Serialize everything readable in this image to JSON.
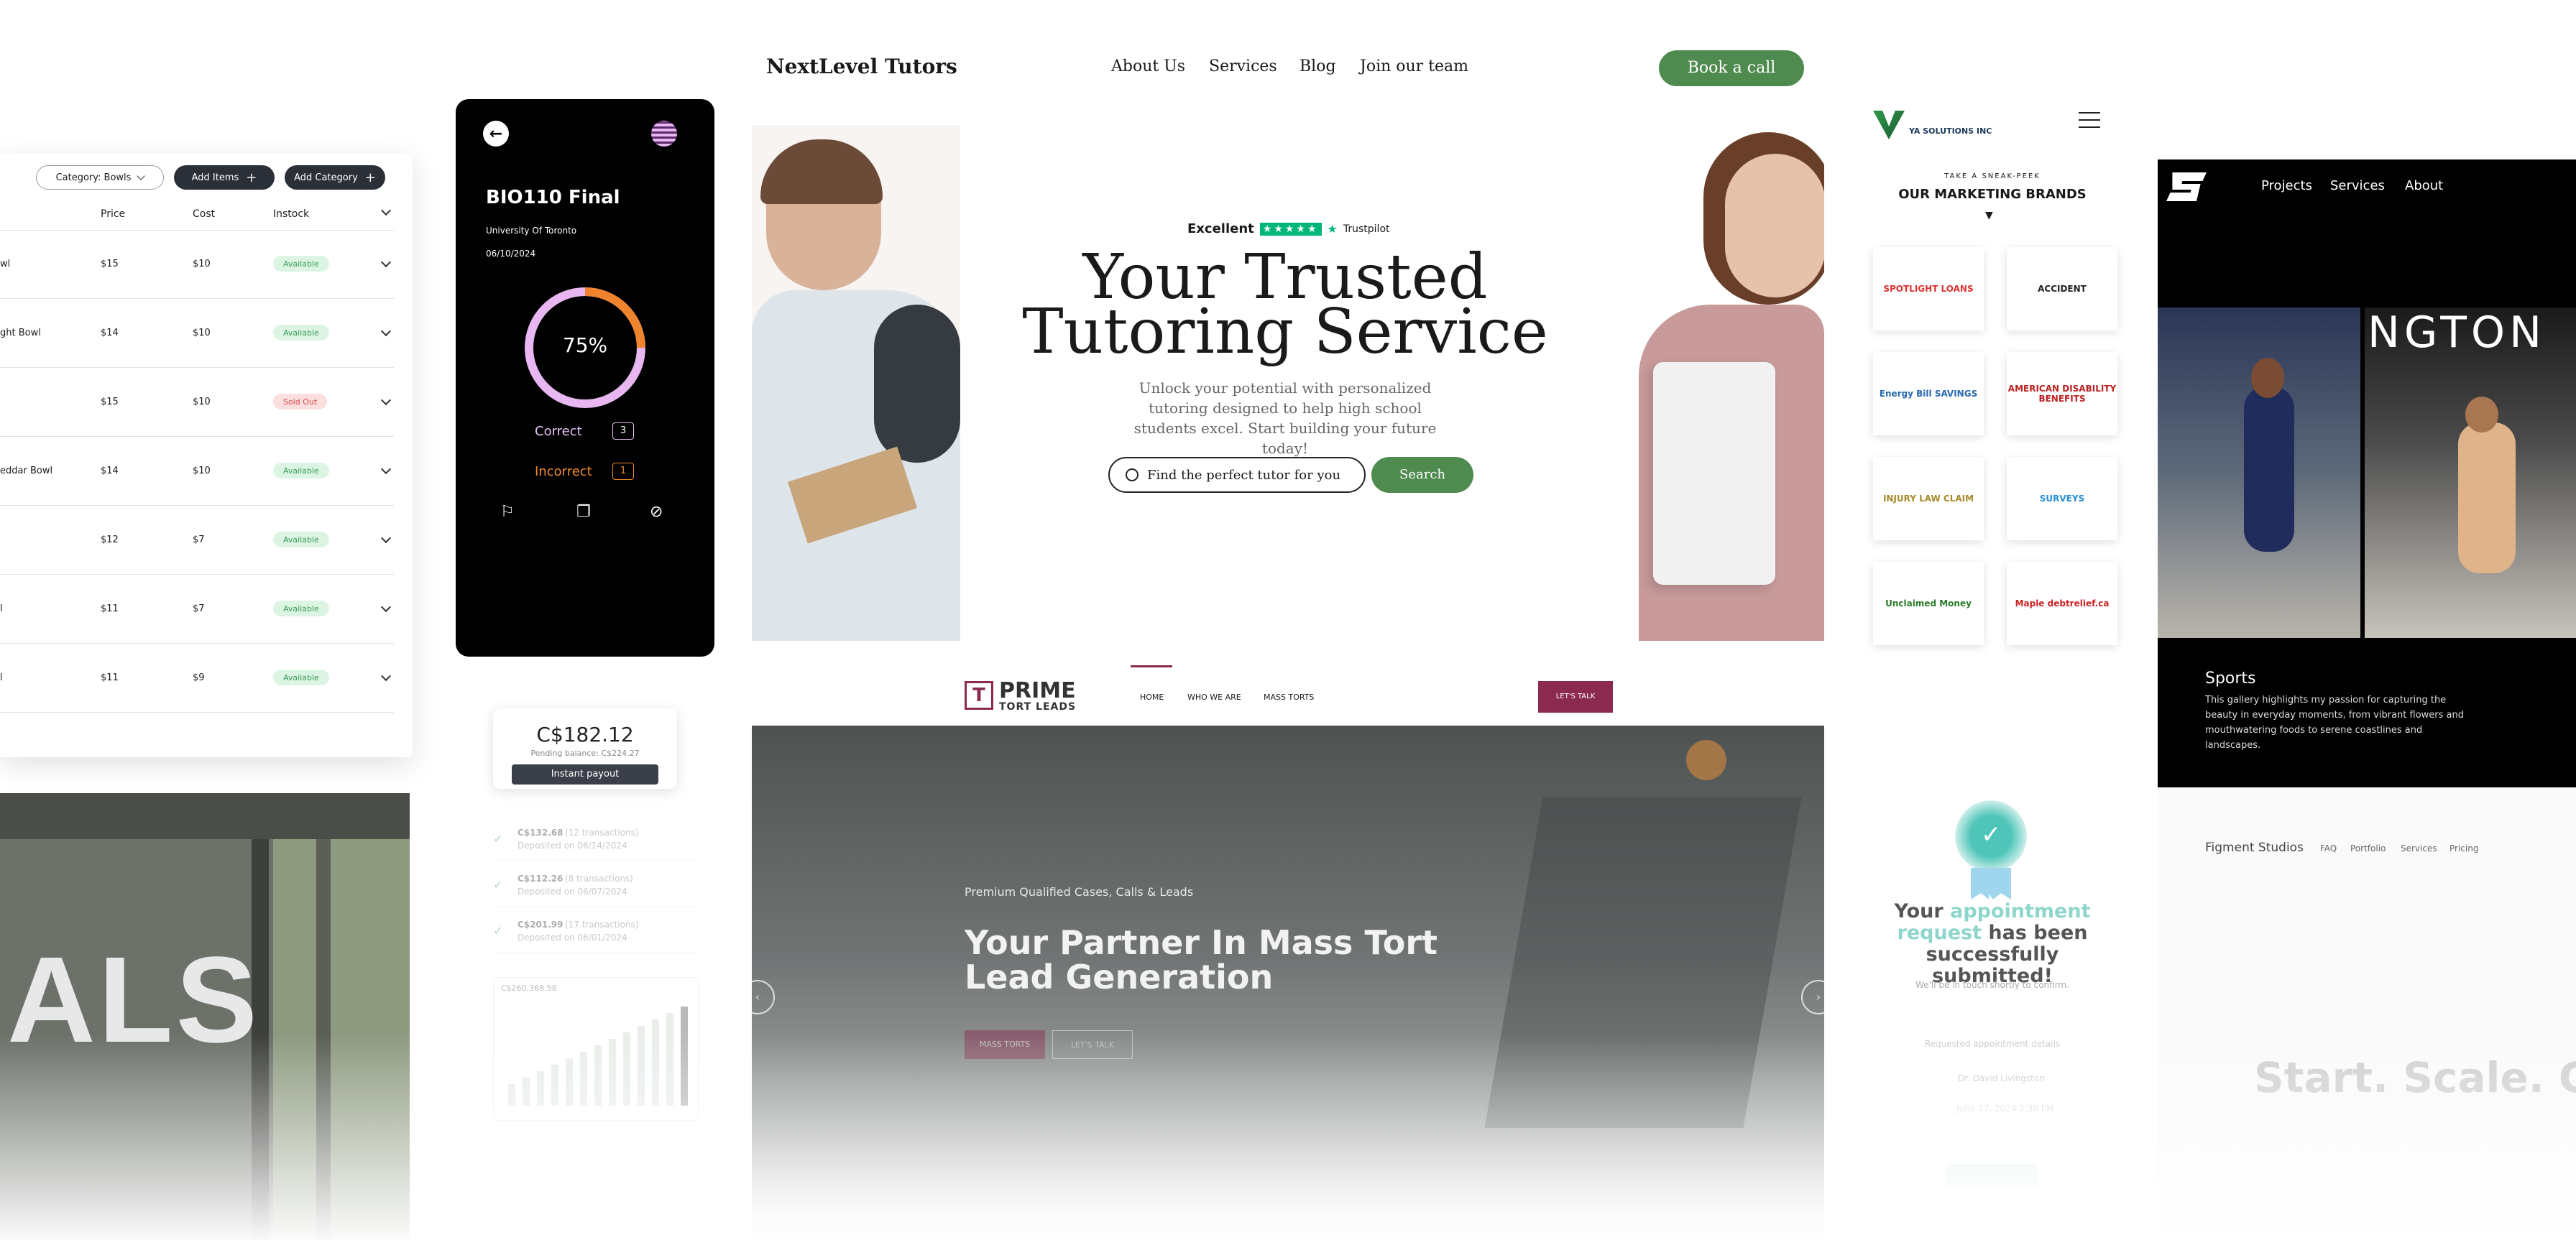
{
  "inventory": {
    "category_button": "Category: Bowls",
    "add_items": "Add Items",
    "add_category": "Add Category",
    "columns": [
      "Price",
      "Cost",
      "Instock"
    ],
    "rows": [
      {
        "name": "wl",
        "price": "$15",
        "cost": "$10",
        "status": "Available"
      },
      {
        "name": "ght Bowl",
        "price": "$14",
        "cost": "$10",
        "status": "Available"
      },
      {
        "name": "",
        "price": "$15",
        "cost": "$10",
        "status": "Sold Out"
      },
      {
        "name": "eddar Bowl",
        "price": "$14",
        "cost": "$10",
        "status": "Available"
      },
      {
        "name": "",
        "price": "$12",
        "cost": "$7",
        "status": "Available"
      },
      {
        "name": "l",
        "price": "$11",
        "cost": "$7",
        "status": "Available"
      },
      {
        "name": "l",
        "price": "$11",
        "cost": "$9",
        "status": "Available"
      }
    ],
    "colors": {
      "available_bg": "#dcf5e3",
      "available_text": "#3a9a5b",
      "soldout_bg": "#fbdede",
      "soldout_text": "#d24b4b",
      "dark_button": "#2b2f38"
    }
  },
  "meals_photo": {
    "text": "ALS"
  },
  "quiz": {
    "title": "BIO110 Final",
    "school": "University Of Toronto",
    "date": "06/10/2024",
    "percent": "75%",
    "progress_fraction": 0.75,
    "correct_label": "Correct",
    "correct_count": "3",
    "incorrect_label": "Incorrect",
    "incorrect_count": "1",
    "colors": {
      "ring": "#e8b6f0",
      "ring_accent": "#f0832e",
      "correct": "#e4c2f4",
      "incorrect": "#f08a2e"
    }
  },
  "payout": {
    "amount": "C$182.12",
    "pending": "Pending balance: C$224.27",
    "button": "Instant payout",
    "transactions": [
      {
        "amount": "C$132.68",
        "count": "(12 transactions)",
        "date": "Deposited on 06/14/2024"
      },
      {
        "amount": "C$112.26",
        "count": "(8 transactions)",
        "date": "Deposited on 06/07/2024"
      },
      {
        "amount": "C$201.99",
        "count": "(17 transactions)",
        "date": "Deposited on 06/01/2024"
      }
    ],
    "chart_total": "C$260,368.58"
  },
  "tutors": {
    "logo": "NextLevel Tutors",
    "nav": [
      "About Us",
      "Services",
      "Blog",
      "Join our team"
    ],
    "cta": "Book a call",
    "rating_label": "Excellent",
    "trustpilot": "Trustpilot",
    "headline_1": "Your Trusted",
    "headline_2": "Tutoring Service",
    "subtext": "Unlock your potential with personalized tutoring designed to help high school students excel. Start building your future today!",
    "search_placeholder": "Find the perfect tutor for you",
    "search_button": "Search",
    "colors": {
      "green": "#4f8a4f"
    }
  },
  "ya": {
    "logo": "YA SOLUTIONS INC",
    "kicker": "TAKE A SNEAK-PEEK",
    "heading": "OUR MARKETING BRANDS",
    "brands": [
      "SPOTLIGHT LOANS",
      "ACCIDENT",
      "Energy Bill SAVINGS",
      "AMERICAN DISABILITY BENEFITS",
      "INJURY LAW CLAIM",
      "SURVEYS",
      "Unclaimed Money",
      "Maple debtrelief.ca"
    ]
  },
  "prime": {
    "logo_1": "PRIME",
    "logo_2": "TORT LEADS",
    "nav": [
      "HOME",
      "WHO WE ARE",
      "MASS TORTS"
    ],
    "cta": "LET'S TALK",
    "kicker": "Premium Qualified Cases, Calls & Leads",
    "headline": "Your Partner In Mass Tort Lead Generation",
    "btn_1": "MASS TORTS",
    "btn_2": "LET'S TALK",
    "colors": {
      "maroon": "#8b2a4e"
    }
  },
  "sports": {
    "nav": [
      "Projects",
      "Services",
      "About"
    ],
    "banner_text": "NGTON",
    "title": "Sports",
    "desc": "This gallery highlights my passion for capturing the beauty in everyday moments, from vibrant flowers and mouthwatering foods to serene coastlines and landscapes."
  },
  "figment": {
    "logo": "Figment Studios",
    "nav": [
      "FAQ",
      "Portfolio",
      "Services",
      "Pricing"
    ],
    "headline": "Start. Scale. Gro"
  },
  "appointment": {
    "msg_1": "Your",
    "msg_2": "appointment request",
    "msg_3": "has been successfully submitted!",
    "sub": "We'll be in touch shortly to confirm.",
    "details_label": "Requested appointment details",
    "doctor": "Dr. David Livingston",
    "date": "June 27, 2024 2:30 PM"
  }
}
